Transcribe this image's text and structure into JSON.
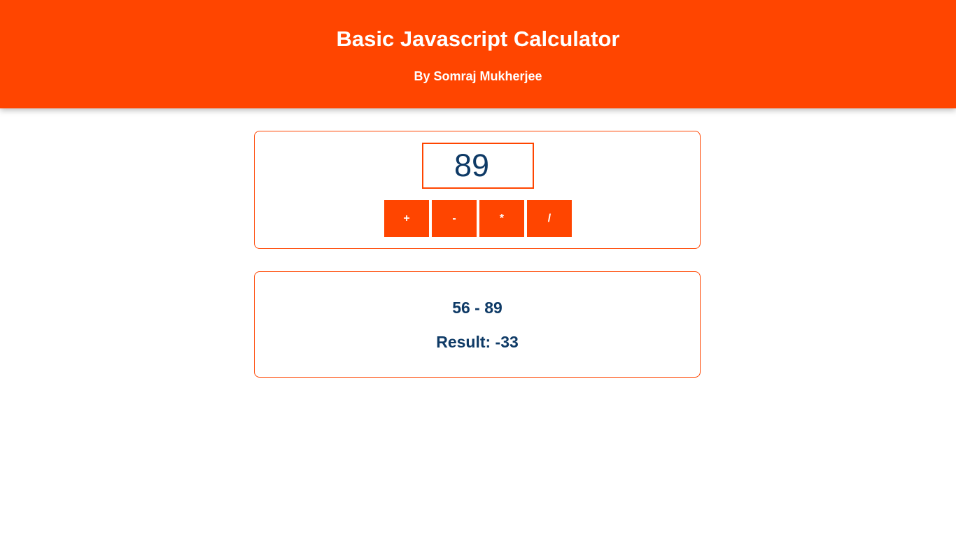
{
  "header": {
    "title": "Basic Javascript Calculator",
    "subtitle": "By Somraj Mukherjee"
  },
  "input": {
    "value": "89"
  },
  "operators": [
    {
      "label": "+"
    },
    {
      "label": "-"
    },
    {
      "label": "*"
    },
    {
      "label": "/"
    }
  ],
  "output": {
    "expression": "56 - 89",
    "result": "Result: -33"
  },
  "colors": {
    "accent": "#ff4500",
    "text": "#0e3a66",
    "background": "#ffffff"
  }
}
